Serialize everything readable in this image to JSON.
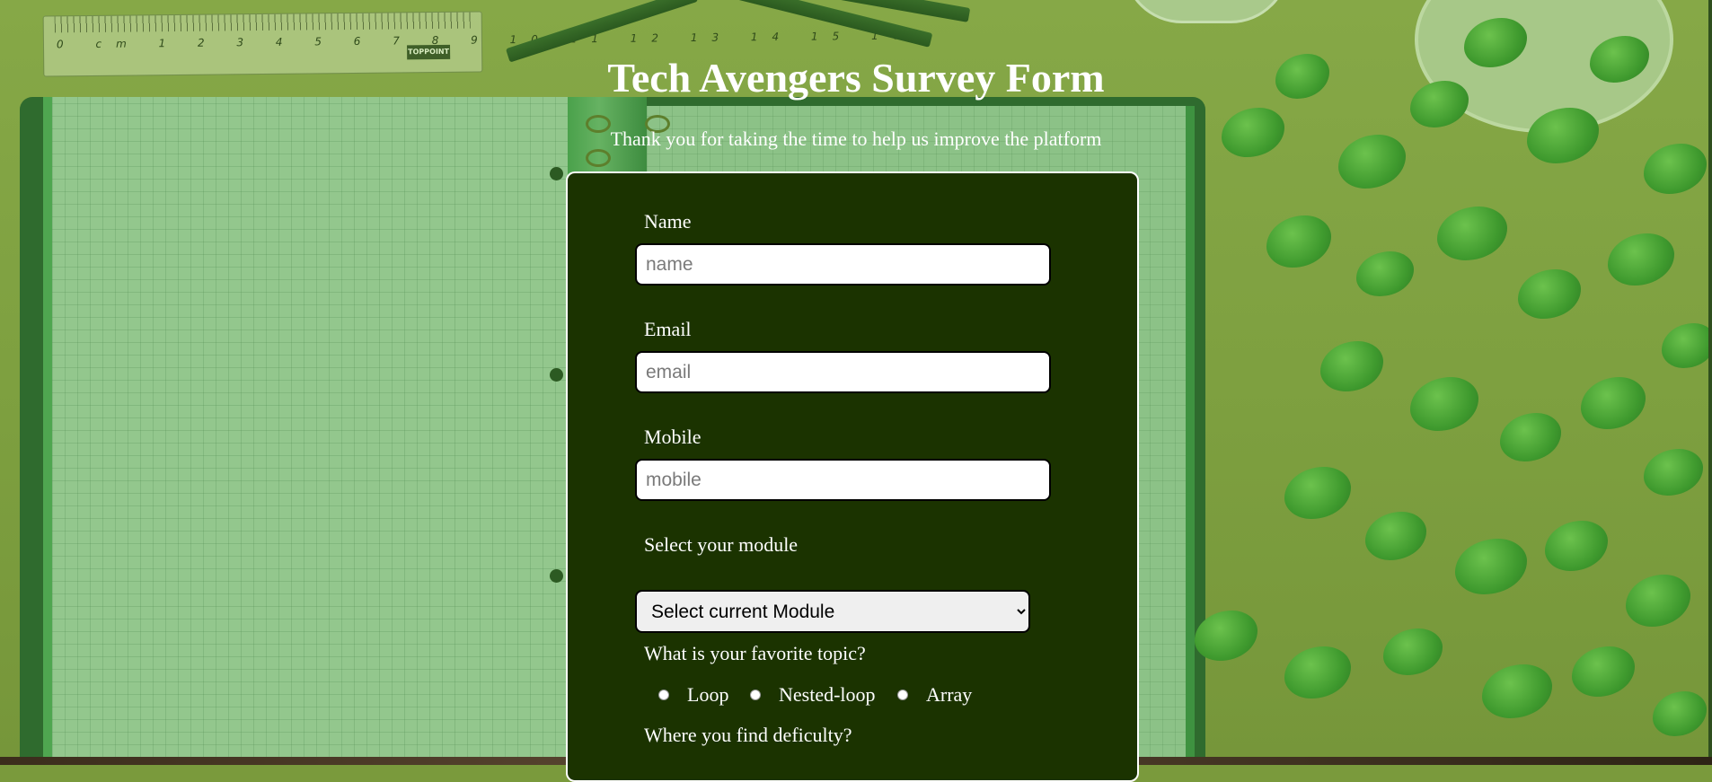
{
  "header": {
    "title": "Tech Avengers Survey Form",
    "subtitle": "Thank you for taking the time to help us improve the platform"
  },
  "background": {
    "ruler_numbers": "0 cm 1 2 3 4 5 6 7 8 9 10 11 12 13 14 15 16",
    "ruler_brand": "TOPPOINT"
  },
  "form": {
    "name": {
      "label": "Name",
      "placeholder": "name",
      "value": ""
    },
    "email": {
      "label": "Email",
      "placeholder": "email",
      "value": ""
    },
    "mobile": {
      "label": "Mobile",
      "placeholder": "mobile",
      "value": ""
    },
    "module": {
      "label": "Select your module",
      "selected": "Select current Module"
    },
    "favorite_topic": {
      "label": "What is your favorite topic?",
      "options": [
        "Loop",
        "Nested-loop",
        "Array"
      ]
    },
    "difficulty": {
      "label": "Where you find deficulty?"
    }
  },
  "colors": {
    "card_background": "#1b3300",
    "page_background": "#7d9f3f",
    "text": "#ffffff"
  }
}
